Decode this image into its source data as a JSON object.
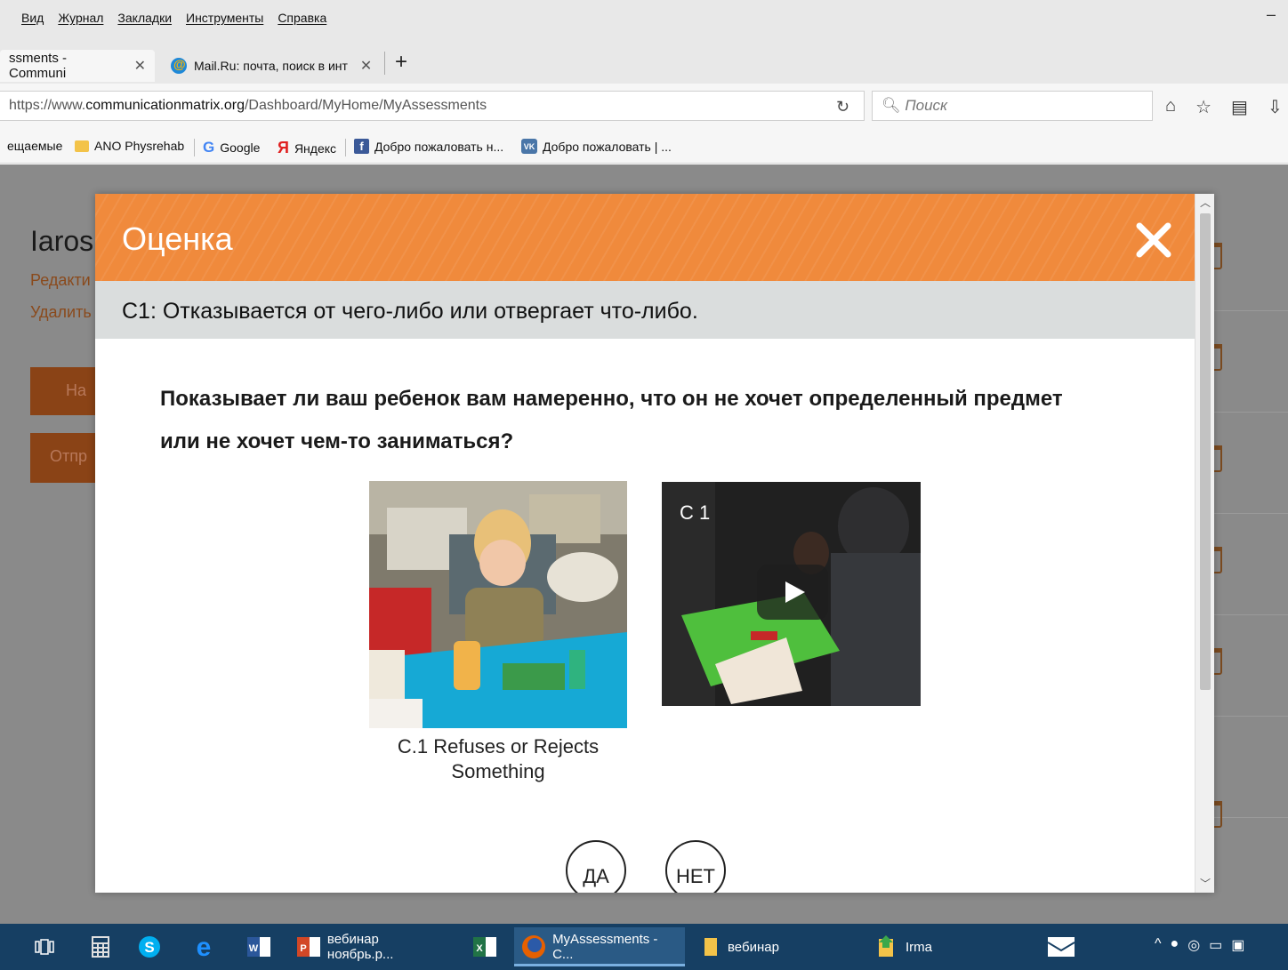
{
  "menu": {
    "items": [
      "Вид",
      "Журнал",
      "Закладки",
      "Инструменты",
      "Справка"
    ],
    "minimize": "–"
  },
  "tabs": [
    {
      "label": "ssments - Communi",
      "active": true
    },
    {
      "label": "Mail.Ru: почта, поиск в инт",
      "active": false
    }
  ],
  "tab_close": "✕",
  "new_tab": "+",
  "url": {
    "prefix": "https://www.",
    "domain": "communicationmatrix.org",
    "path": "/Dashboard/MyHome/MyAssessments"
  },
  "search": {
    "placeholder": "Поиск"
  },
  "bookmarks": [
    "ещаемые",
    "ANO Physrehab",
    "Google",
    "Яндекс",
    "Добро пожаловать н...",
    "Добро пожаловать | ..."
  ],
  "background": {
    "name": "Iaros",
    "edit_link": "Редакти",
    "delete_link": "Удалить",
    "start_button": "На",
    "send_button": "Отпр"
  },
  "modal": {
    "title": "Оценка",
    "question_code": "C1: Отказывается от чего-либо или отвергает что-либо.",
    "question_part1": "Показывает ли ваш ребенок вам ",
    "question_strong": "намеренно",
    "question_part2": ", что он не хочет определенный предмет или не хочет чем-то заниматься?",
    "photo_caption_line1": "C.1 Refuses or Rejects",
    "photo_caption_line2": "Something",
    "video_label": "C 1",
    "yes": "ДА",
    "no": "НЕТ"
  },
  "taskbar": {
    "apps": [
      {
        "label": "вебинар ноябрь.р...",
        "active": false
      },
      {
        "label": "MyAssessments - C...",
        "active": true
      },
      {
        "label": "вебинар",
        "active": false
      },
      {
        "label": "Irma",
        "active": false
      }
    ]
  },
  "colors": {
    "accent": "#f08a3c",
    "taskbar": "#163f63",
    "question_bar": "#dadddd"
  }
}
